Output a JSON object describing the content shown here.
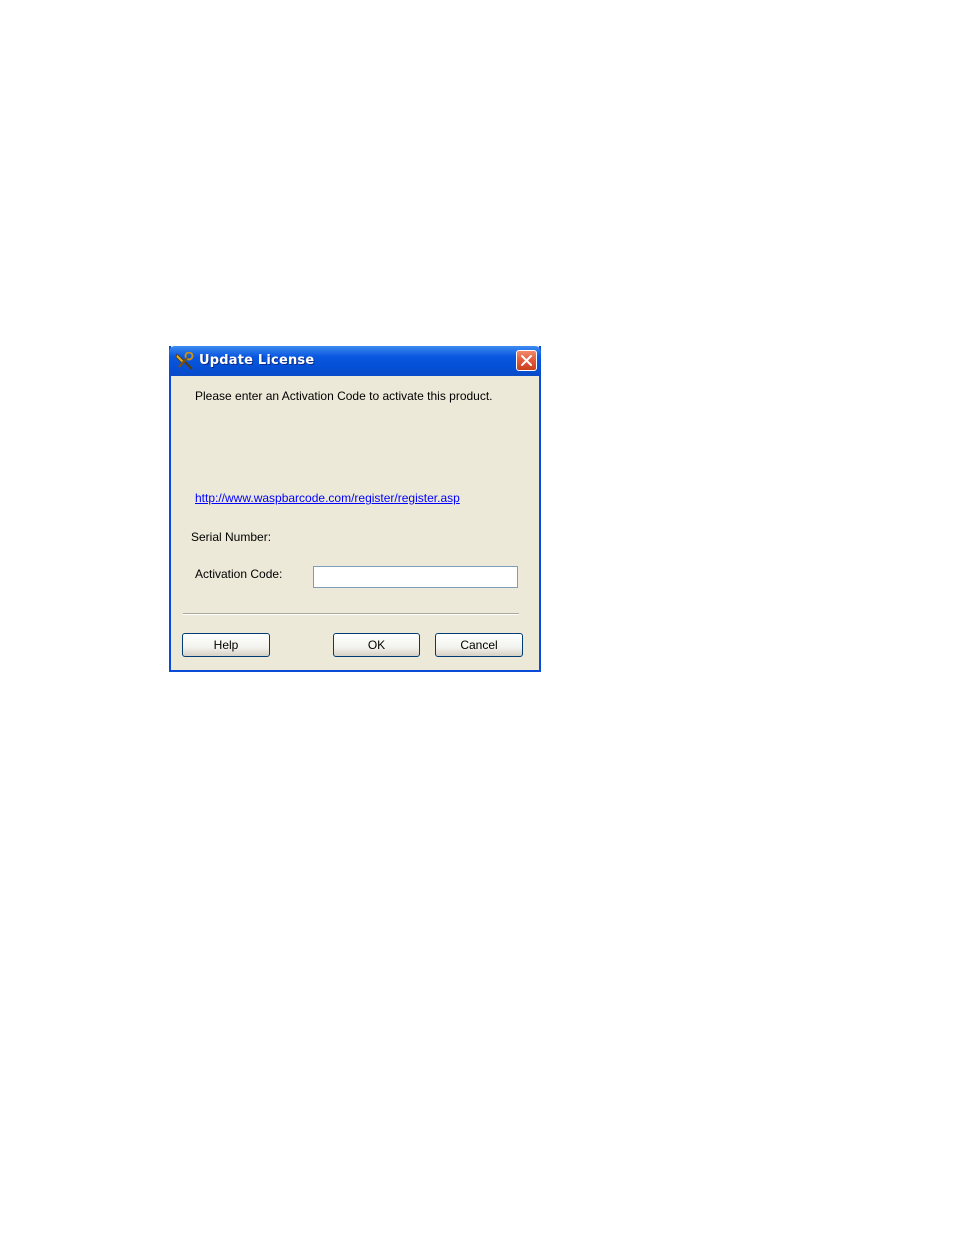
{
  "dialog": {
    "title": "Update License",
    "app_icon": "key-tools-icon",
    "close_icon": "close-icon",
    "message": "Please enter an Activation Code to activate this product.",
    "link_text": "http://www.waspbarcode.com/register/register.asp",
    "serial_label": "Serial Number:",
    "serial_value": "",
    "activation_label": "Activation Code:",
    "activation_value": "",
    "buttons": {
      "help": "Help",
      "ok": "OK",
      "cancel": "Cancel"
    }
  },
  "colors": {
    "titlebar": "#0450d6",
    "dialog_bg": "#ece9d8",
    "link": "#0000ff",
    "close": "#e2593a"
  }
}
